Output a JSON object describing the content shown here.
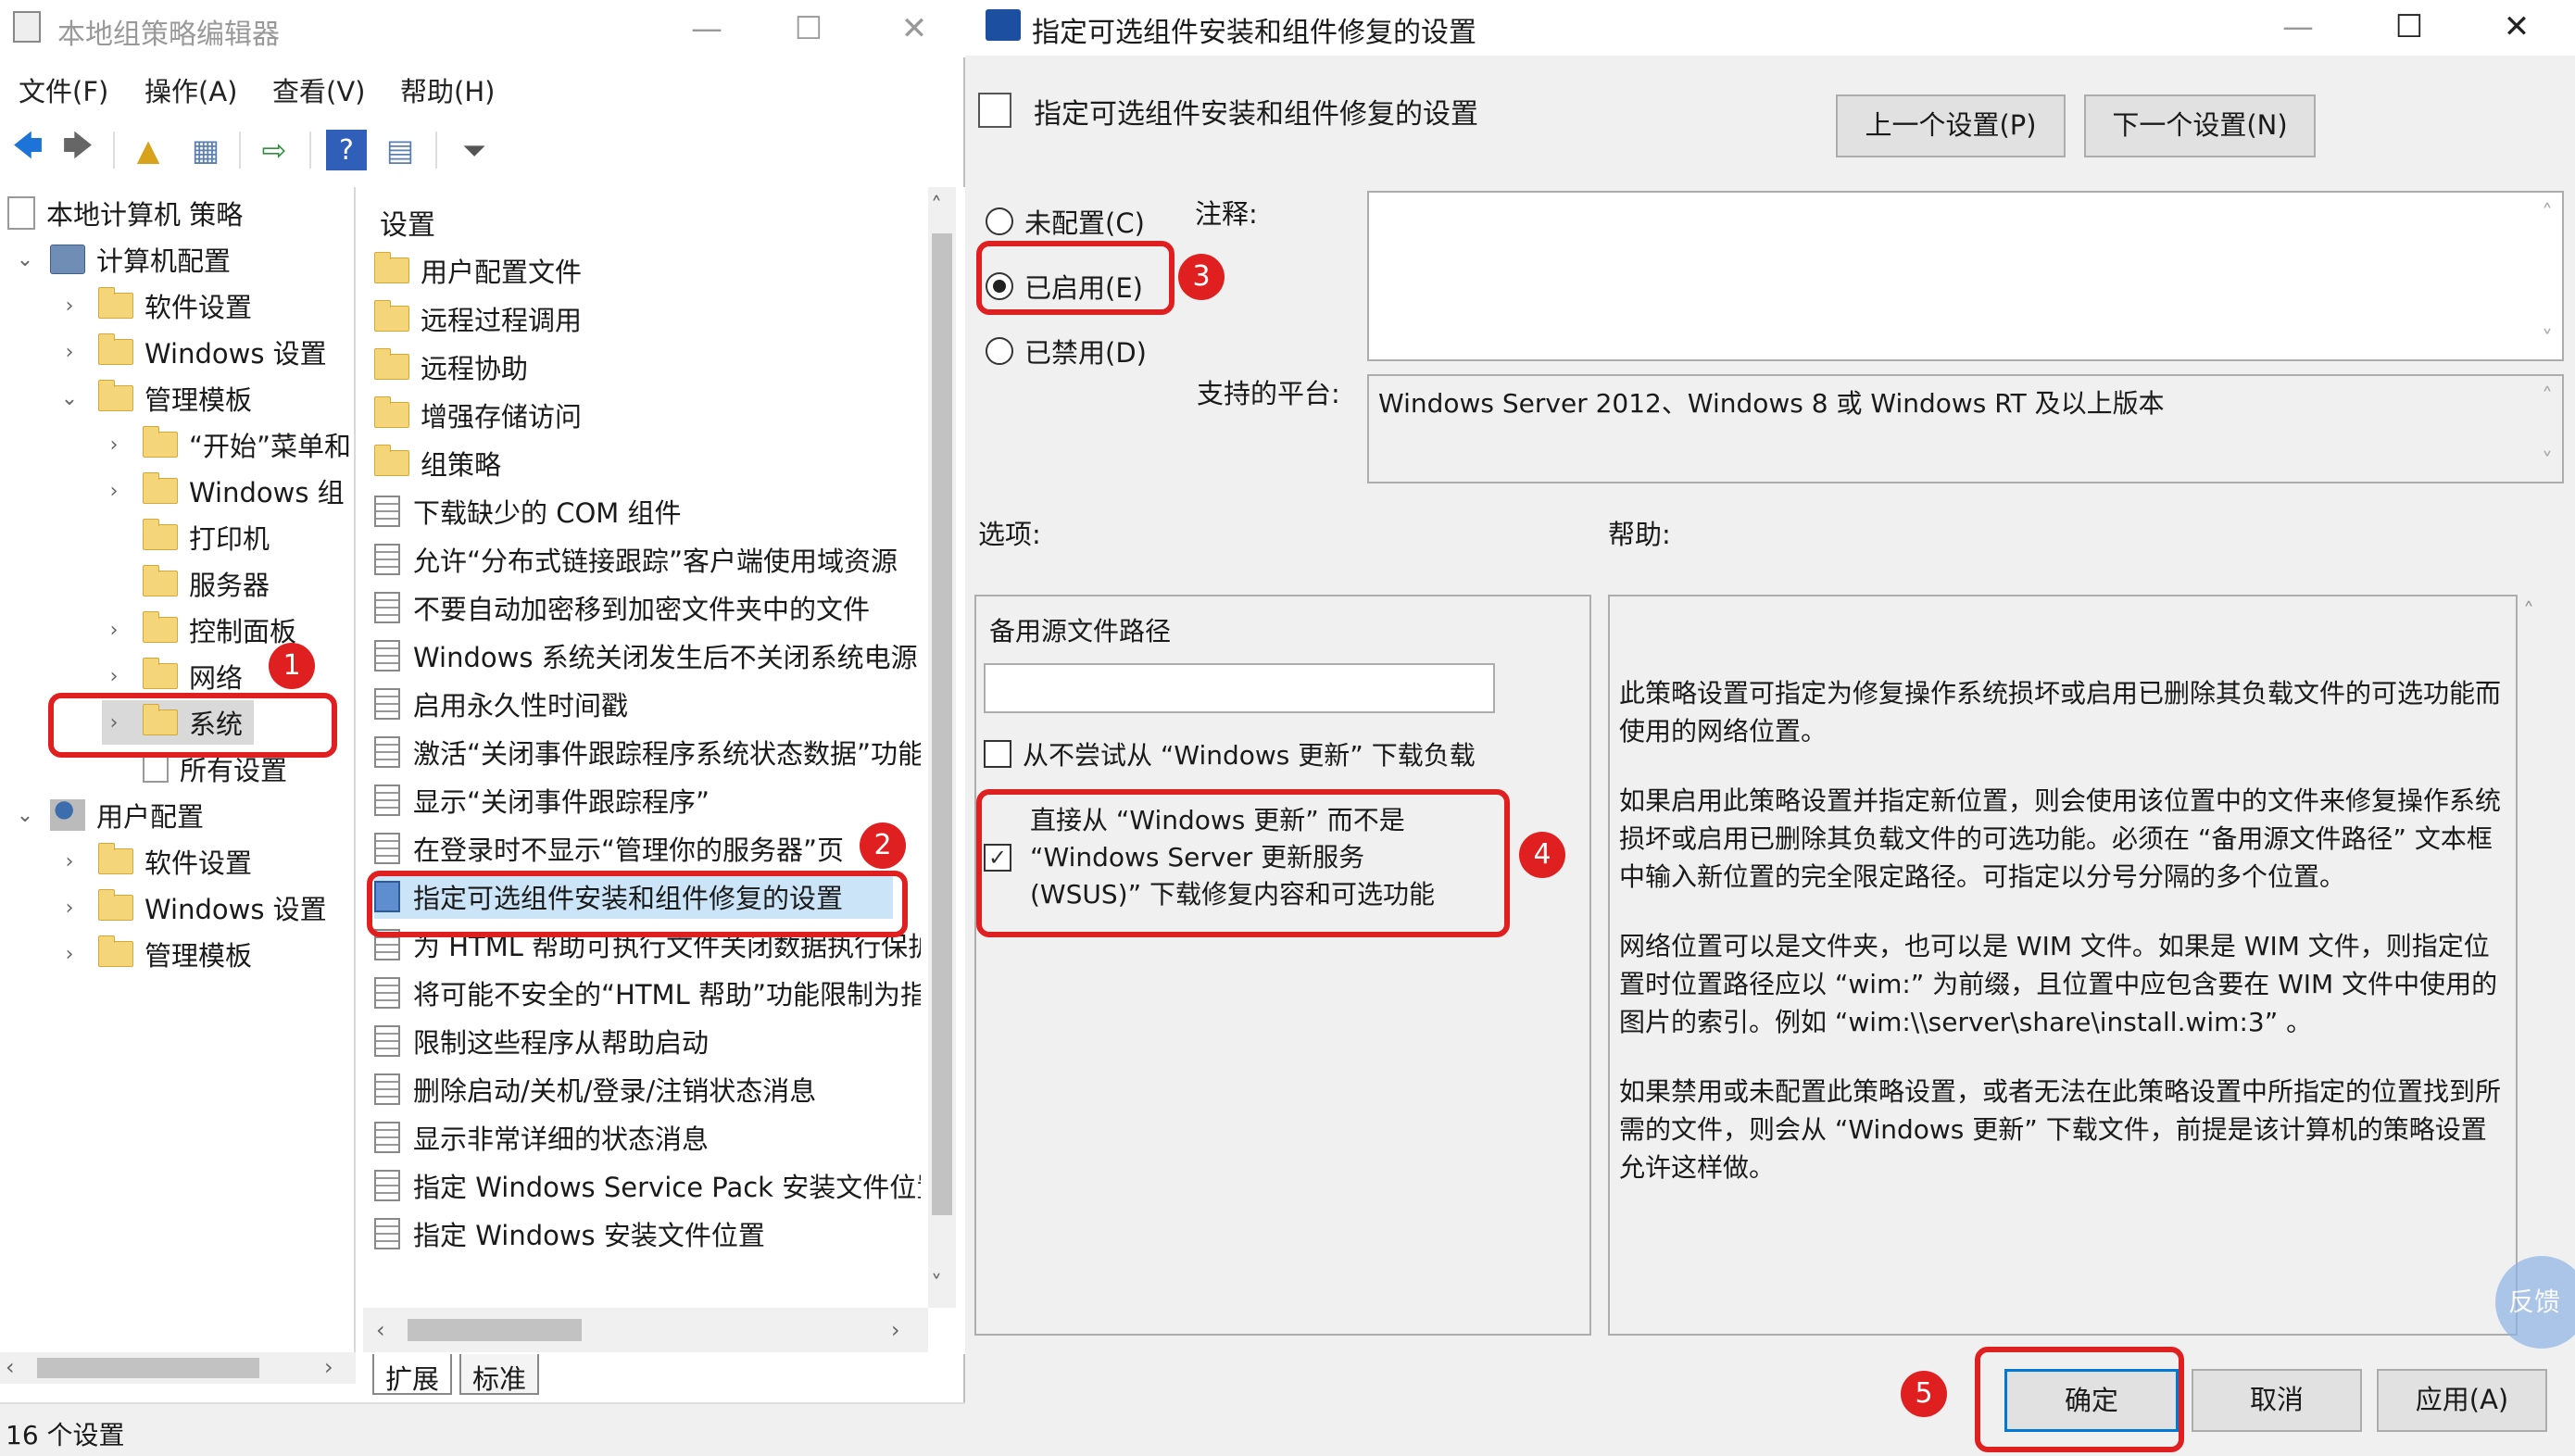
{
  "gpedit": {
    "title": "本地组策略编辑器",
    "menu": [
      "文件(F)",
      "操作(A)",
      "查看(V)",
      "帮助(H)"
    ],
    "tree": [
      {
        "label": "本地计算机 策略"
      },
      {
        "label": "计算机配置"
      },
      {
        "label": "软件设置"
      },
      {
        "label": "Windows 设置"
      },
      {
        "label": "管理模板"
      },
      {
        "label": "“开始”菜单和"
      },
      {
        "label": "Windows 组"
      },
      {
        "label": "打印机"
      },
      {
        "label": "服务器"
      },
      {
        "label": "控制面板"
      },
      {
        "label": "网络"
      },
      {
        "label": "系统"
      },
      {
        "label": "所有设置"
      },
      {
        "label": "用户配置"
      },
      {
        "label": "软件设置"
      },
      {
        "label": "Windows 设置"
      },
      {
        "label": "管理模板"
      }
    ],
    "list_header": "设置",
    "list": [
      "用户配置文件",
      "远程过程调用",
      "远程协助",
      "增强存储访问",
      "组策略",
      "下载缺少的 COM 组件",
      "允许“分布式链接跟踪”客户端使用域资源",
      "不要自动加密移到加密文件夹中的文件",
      "Windows 系统关闭发生后不关闭系统电源",
      "启用永久性时间戳",
      "激活“关闭事件跟踪程序系统状态数据”功能",
      "显示“关闭事件跟踪程序”",
      "在登录时不显示“管理你的服务器”页",
      "指定可选组件安装和组件修复的设置",
      "为 HTML 帮助可执行文件关闭数据执行保护",
      "将可能不安全的“HTML 帮助”功能限制为指定",
      "限制这些程序从帮助启动",
      "删除启动/关机/登录/注销状态消息",
      "显示非常详细的状态消息",
      "指定 Windows Service Pack 安装文件位置",
      "指定 Windows 安装文件位置"
    ],
    "tabs": [
      "扩展",
      "标准"
    ],
    "status": "16 个设置"
  },
  "dialog": {
    "title": "指定可选组件安装和组件修复的设置",
    "heading": "指定可选组件安装和组件修复的设置",
    "prev_button": "上一个设置(P)",
    "next_button": "下一个设置(N)",
    "radio_not_configured": "未配置(C)",
    "radio_enabled": "已启用(E)",
    "radio_disabled": "已禁用(D)",
    "comment_label": "注释:",
    "platform_label": "支持的平台:",
    "platform_value": "Windows Server 2012、Windows 8 或 Windows RT 及以上版本",
    "options_label": "选项:",
    "help_label": "帮助:",
    "alt_source_label": "备用源文件路径",
    "alt_source_value": "",
    "never_download_label": "从不尝试从 “Windows 更新” 下载负载",
    "never_download_checked": false,
    "direct_download_line1": "直接从 “Windows 更新” 而不是",
    "direct_download_line2": "“Windows Server 更新服务",
    "direct_download_line3": "(WSUS)” 下载修复内容和可选功能",
    "direct_download_checked": true,
    "help_paragraphs": [
      "此策略设置可指定为修复操作系统损坏或启用已删除其负载文件的可选功能而使用的网络位置。",
      "如果启用此策略设置并指定新位置，则会使用该位置中的文件来修复操作系统损坏或启用已删除其负载文件的可选功能。必须在 “备用源文件路径” 文本框中输入新位置的完全限定路径。可指定以分号分隔的多个位置。",
      "网络位置可以是文件夹，也可以是 WIM 文件。如果是 WIM 文件，则指定位置时位置路径应以 “wim:” 为前缀，且位置中应包含要在 WIM 文件中使用的图片的索引。例如 “wim:\\\\server\\share\\install.wim:3” 。",
      "如果禁用或未配置此策略设置，或者无法在此策略设置中所指定的位置找到所需的文件，则会从 “Windows 更新” 下载文件，前提是该计算机的策略设置允许这样做。"
    ],
    "ok_button": "确定",
    "cancel_button": "取消",
    "apply_button": "应用(A)",
    "feedback": "反馈"
  },
  "annotations": {
    "badges": [
      "1",
      "2",
      "3",
      "4",
      "5"
    ],
    "color": "#e02020"
  },
  "colors": {
    "accent": "#0078d7",
    "folder": "#f5d57a",
    "dialog_bg": "#f0f0f0"
  }
}
